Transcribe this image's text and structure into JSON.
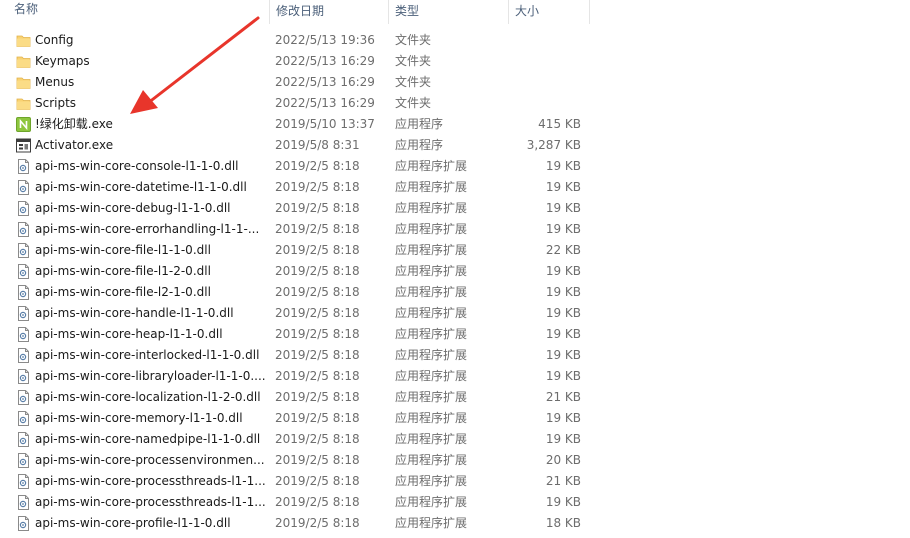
{
  "columns": {
    "name": "名称",
    "date": "修改日期",
    "type": "类型",
    "size": "大小"
  },
  "colors": {
    "header_text": "#4c607a",
    "meta_text": "#6d6d6d",
    "folder": "#f9d272",
    "annotation_arrow": "#e8352b"
  },
  "files": [
    {
      "name": "Config",
      "date": "2022/5/13 19:36",
      "type": "文件夹",
      "size": "",
      "icon": "folder-icon"
    },
    {
      "name": "Keymaps",
      "date": "2022/5/13 16:29",
      "type": "文件夹",
      "size": "",
      "icon": "folder-icon"
    },
    {
      "name": "Menus",
      "date": "2022/5/13 16:29",
      "type": "文件夹",
      "size": "",
      "icon": "folder-icon"
    },
    {
      "name": "Scripts",
      "date": "2022/5/13 16:29",
      "type": "文件夹",
      "size": "",
      "icon": "folder-icon"
    },
    {
      "name": "!绿化卸载.exe",
      "date": "2019/5/10 13:37",
      "type": "应用程序",
      "size": "415 KB",
      "icon": "green-n-app-icon"
    },
    {
      "name": "Activator.exe",
      "date": "2019/5/8 8:31",
      "type": "应用程序",
      "size": "3,287 KB",
      "icon": "application-window-icon"
    },
    {
      "name": "api-ms-win-core-console-l1-1-0.dll",
      "date": "2019/2/5 8:18",
      "type": "应用程序扩展",
      "size": "19 KB",
      "icon": "dll-file-icon"
    },
    {
      "name": "api-ms-win-core-datetime-l1-1-0.dll",
      "date": "2019/2/5 8:18",
      "type": "应用程序扩展",
      "size": "19 KB",
      "icon": "dll-file-icon"
    },
    {
      "name": "api-ms-win-core-debug-l1-1-0.dll",
      "date": "2019/2/5 8:18",
      "type": "应用程序扩展",
      "size": "19 KB",
      "icon": "dll-file-icon"
    },
    {
      "name": "api-ms-win-core-errorhandling-l1-1-...",
      "date": "2019/2/5 8:18",
      "type": "应用程序扩展",
      "size": "19 KB",
      "icon": "dll-file-icon"
    },
    {
      "name": "api-ms-win-core-file-l1-1-0.dll",
      "date": "2019/2/5 8:18",
      "type": "应用程序扩展",
      "size": "22 KB",
      "icon": "dll-file-icon"
    },
    {
      "name": "api-ms-win-core-file-l1-2-0.dll",
      "date": "2019/2/5 8:18",
      "type": "应用程序扩展",
      "size": "19 KB",
      "icon": "dll-file-icon"
    },
    {
      "name": "api-ms-win-core-file-l2-1-0.dll",
      "date": "2019/2/5 8:18",
      "type": "应用程序扩展",
      "size": "19 KB",
      "icon": "dll-file-icon"
    },
    {
      "name": "api-ms-win-core-handle-l1-1-0.dll",
      "date": "2019/2/5 8:18",
      "type": "应用程序扩展",
      "size": "19 KB",
      "icon": "dll-file-icon"
    },
    {
      "name": "api-ms-win-core-heap-l1-1-0.dll",
      "date": "2019/2/5 8:18",
      "type": "应用程序扩展",
      "size": "19 KB",
      "icon": "dll-file-icon"
    },
    {
      "name": "api-ms-win-core-interlocked-l1-1-0.dll",
      "date": "2019/2/5 8:18",
      "type": "应用程序扩展",
      "size": "19 KB",
      "icon": "dll-file-icon"
    },
    {
      "name": "api-ms-win-core-libraryloader-l1-1-0....",
      "date": "2019/2/5 8:18",
      "type": "应用程序扩展",
      "size": "19 KB",
      "icon": "dll-file-icon"
    },
    {
      "name": "api-ms-win-core-localization-l1-2-0.dll",
      "date": "2019/2/5 8:18",
      "type": "应用程序扩展",
      "size": "21 KB",
      "icon": "dll-file-icon"
    },
    {
      "name": "api-ms-win-core-memory-l1-1-0.dll",
      "date": "2019/2/5 8:18",
      "type": "应用程序扩展",
      "size": "19 KB",
      "icon": "dll-file-icon"
    },
    {
      "name": "api-ms-win-core-namedpipe-l1-1-0.dll",
      "date": "2019/2/5 8:18",
      "type": "应用程序扩展",
      "size": "19 KB",
      "icon": "dll-file-icon"
    },
    {
      "name": "api-ms-win-core-processenvironmen...",
      "date": "2019/2/5 8:18",
      "type": "应用程序扩展",
      "size": "20 KB",
      "icon": "dll-file-icon"
    },
    {
      "name": "api-ms-win-core-processthreads-l1-1...",
      "date": "2019/2/5 8:18",
      "type": "应用程序扩展",
      "size": "21 KB",
      "icon": "dll-file-icon"
    },
    {
      "name": "api-ms-win-core-processthreads-l1-1...",
      "date": "2019/2/5 8:18",
      "type": "应用程序扩展",
      "size": "19 KB",
      "icon": "dll-file-icon"
    },
    {
      "name": "api-ms-win-core-profile-l1-1-0.dll",
      "date": "2019/2/5 8:18",
      "type": "应用程序扩展",
      "size": "18 KB",
      "icon": "dll-file-icon"
    }
  ]
}
